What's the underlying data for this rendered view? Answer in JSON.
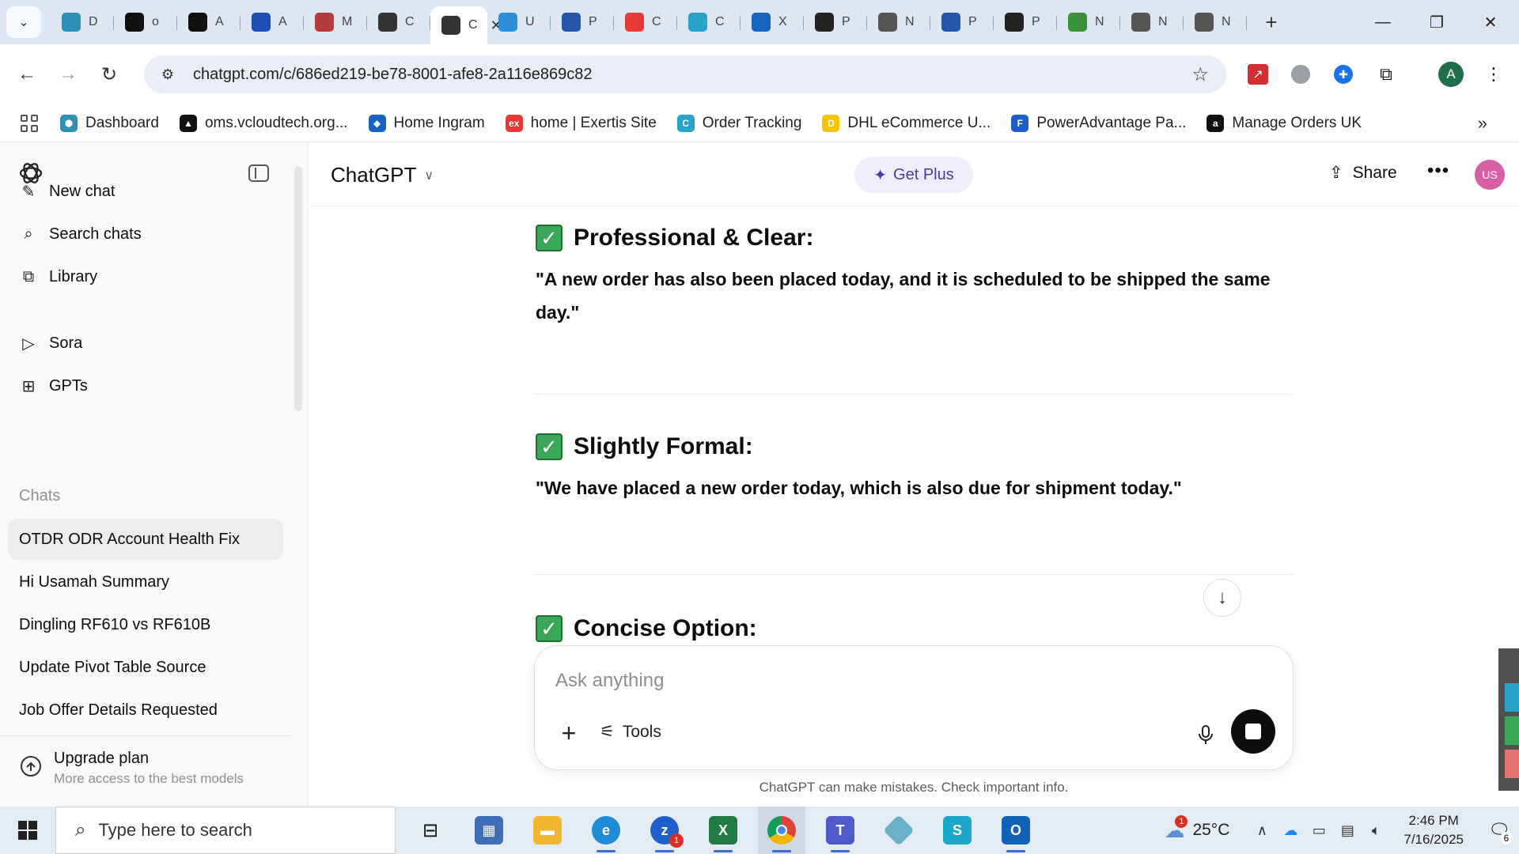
{
  "browser": {
    "tabs": [
      {
        "label": "D",
        "icon": "hexagon-icon",
        "color": "#2e8fb7"
      },
      {
        "label": "o",
        "icon": "triangle-icon",
        "color": "#111111"
      },
      {
        "label": "A",
        "icon": "amazon-icon",
        "color": "#111111"
      },
      {
        "label": "A",
        "icon": "arrow-icon",
        "color": "#1f4fb5"
      },
      {
        "label": "M",
        "icon": "rings-icon",
        "color": "#b53c3c"
      },
      {
        "label": "C",
        "icon": "openai-icon",
        "color": "#333333"
      },
      {
        "label": "C",
        "icon": "openai-icon",
        "color": "#333333",
        "active": true
      },
      {
        "label": "U",
        "icon": "globe-icon",
        "color": "#2e8fd8"
      },
      {
        "label": "P",
        "icon": "e-icon",
        "color": "#2457a8"
      },
      {
        "label": "C",
        "icon": "ex-icon",
        "color": "#e53935"
      },
      {
        "label": "C",
        "icon": "c-icon",
        "color": "#2aa3c9"
      },
      {
        "label": "X",
        "icon": "x-icon",
        "color": "#1565c0"
      },
      {
        "label": "P",
        "icon": "pa-icon",
        "color": "#222222"
      },
      {
        "label": "N",
        "icon": "chrome-icon",
        "color": "#555555"
      },
      {
        "label": "P",
        "icon": "e-icon",
        "color": "#2457a8"
      },
      {
        "label": "P",
        "icon": "pa-icon",
        "color": "#222222"
      },
      {
        "label": "N",
        "icon": "nex-icon",
        "color": "#3b8f3b"
      },
      {
        "label": "N",
        "icon": "chrome-icon",
        "color": "#555555"
      },
      {
        "label": "N",
        "icon": "chrome-icon",
        "color": "#555555"
      }
    ],
    "url": "chatgpt.com/c/686ed219-be78-8001-afe8-2a116e869c82",
    "profile_initial": "A",
    "bookmarks": [
      {
        "label": "Dashboard",
        "color": "#2e8fb7",
        "glyph": "⬢"
      },
      {
        "label": "oms.vcloudtech.org...",
        "color": "#111111",
        "glyph": "▲"
      },
      {
        "label": "Home Ingram",
        "color": "#1565c0",
        "glyph": "◆"
      },
      {
        "label": "home | Exertis Site",
        "color": "#e53935",
        "glyph": "ex"
      },
      {
        "label": "Order Tracking",
        "color": "#2aa3c9",
        "glyph": "C"
      },
      {
        "label": "DHL eCommerce U...",
        "color": "#f5c400",
        "glyph": "D"
      },
      {
        "label": "PowerAdvantage Pa...",
        "color": "#1e5fc9",
        "glyph": "F"
      },
      {
        "label": "Manage Orders UK",
        "color": "#111111",
        "glyph": "a"
      }
    ]
  },
  "sidebar": {
    "nav": [
      {
        "label": "New chat",
        "icon": "edit-icon"
      },
      {
        "label": "Search chats",
        "icon": "search-icon"
      },
      {
        "label": "Library",
        "icon": "library-icon"
      },
      {
        "label": "Sora",
        "icon": "play-icon"
      },
      {
        "label": "GPTs",
        "icon": "grid-icon"
      }
    ],
    "section_label": "Chats",
    "chats": [
      "OTDR ODR Account Health Fix",
      "Hi Usamah Summary",
      "Dingling RF610 vs RF610B",
      "Update Pivot Table Source",
      "Job Offer Details Requested"
    ],
    "upgrade": {
      "title": "Upgrade plan",
      "subtitle": "More access to the best models"
    }
  },
  "header": {
    "model": "ChatGPT",
    "get_plus": "Get Plus",
    "share": "Share",
    "avatar_initials": "US"
  },
  "conversation": {
    "options": [
      {
        "title": "Professional & Clear:",
        "quote": "\"A new order has also been placed today, and it is scheduled to be shipped the same day.\""
      },
      {
        "title": "Slightly Formal:",
        "quote": "\"We have placed a new order today, which is also due for shipment today.\""
      },
      {
        "title": "Concise Option:",
        "quote": ""
      }
    ]
  },
  "composer": {
    "placeholder": "Ask anything",
    "tools_label": "Tools",
    "disclaimer": "ChatGPT can make mistakes. Check important info."
  },
  "taskbar": {
    "search_placeholder": "Type here to search",
    "weather": "25°C",
    "weather_badge": "1",
    "time": "2:46 PM",
    "date": "7/16/2025",
    "zoom_badge": "1",
    "notifications": "6"
  }
}
